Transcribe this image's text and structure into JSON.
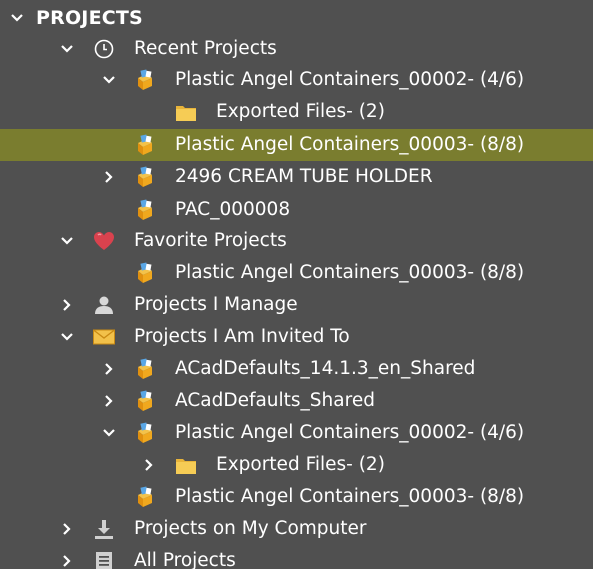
{
  "tree": {
    "header": "PROJECTS",
    "recent_projects": "Recent Projects",
    "pac_00002": "Plastic Angel Containers_00002- (4/6)",
    "exported_files": "Exported Files- (2)",
    "pac_00003": "Plastic Angel Containers_00003- (8/8)",
    "cream_tube": "2496 CREAM TUBE HOLDER",
    "pac_000008": "PAC_000008",
    "favorite_projects": "Favorite Projects",
    "fav_pac_00003": "Plastic Angel Containers_00003- (8/8)",
    "projects_i_manage": "Projects I Manage",
    "projects_invited": "Projects I Am Invited To",
    "acad_1413": "ACadDefaults_14.1.3_en_Shared",
    "acad_shared": "ACadDefaults_Shared",
    "inv_pac_00002": "Plastic Angel Containers_00002- (4/6)",
    "inv_exported_files": "Exported Files- (2)",
    "inv_pac_00003": "Plastic Angel Containers_00003- (8/8)",
    "projects_on_computer": "Projects on My Computer",
    "all_projects": "All Projects"
  },
  "colors": {
    "panel_bg": "#505050",
    "selected_bg": "#7a7d2f",
    "text": "#ffffff"
  },
  "icons": {
    "recent": "clock-icon",
    "project": "project-box-icon",
    "folder": "folder-icon",
    "favorite": "heart-icon",
    "manage": "person-icon",
    "invited": "envelope-icon",
    "computer": "download-icon",
    "all": "list-icon"
  }
}
